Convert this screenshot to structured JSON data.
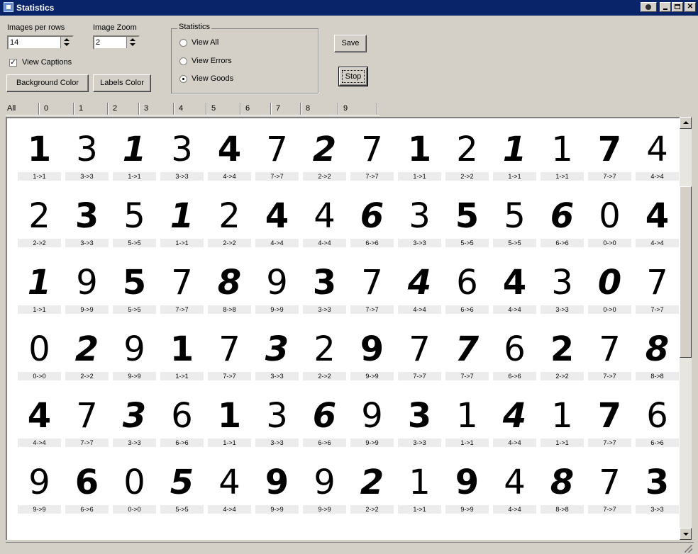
{
  "window": {
    "title": "Statistics"
  },
  "controls": {
    "images_per_row_label": "Images per rows",
    "images_per_row_value": "14",
    "image_zoom_label": "Image Zoom",
    "image_zoom_value": "2",
    "view_captions_label": "View Captions",
    "view_captions_checked": true,
    "background_color_button": "Background Color",
    "labels_color_button": "Labels Color"
  },
  "statistics_group": {
    "title": "Statistics",
    "options": [
      {
        "label": "View All",
        "selected": false
      },
      {
        "label": "View Errors",
        "selected": false
      },
      {
        "label": "View Goods",
        "selected": true
      }
    ]
  },
  "buttons": {
    "save": "Save",
    "stop": "Stop"
  },
  "tabs": [
    "All",
    "0",
    "1",
    "2",
    "3",
    "4",
    "5",
    "6",
    "7",
    "8",
    "9"
  ],
  "active_tab": "All",
  "grid": {
    "rows": [
      {
        "digits": [
          "1",
          "3",
          "1",
          "3",
          "4",
          "7",
          "2",
          "7",
          "1",
          "2",
          "1",
          "1",
          "7",
          "4"
        ],
        "captions": [
          "1->1",
          "3->3",
          "1->1",
          "3->3",
          "4->4",
          "7->7",
          "2->2",
          "7->7",
          "1->1",
          "2->2",
          "1->1",
          "1->1",
          "7->7",
          "4->4"
        ]
      },
      {
        "digits": [
          "2",
          "3",
          "5",
          "1",
          "2",
          "4",
          "4",
          "6",
          "3",
          "5",
          "5",
          "6",
          "0",
          "4"
        ],
        "captions": [
          "2->2",
          "3->3",
          "5->5",
          "1->1",
          "2->2",
          "4->4",
          "4->4",
          "6->6",
          "3->3",
          "5->5",
          "5->5",
          "6->6",
          "0->0",
          "4->4"
        ]
      },
      {
        "digits": [
          "1",
          "9",
          "5",
          "7",
          "8",
          "9",
          "3",
          "7",
          "4",
          "6",
          "4",
          "3",
          "0",
          "7"
        ],
        "captions": [
          "1->1",
          "9->9",
          "5->5",
          "7->7",
          "8->8",
          "9->9",
          "3->3",
          "7->7",
          "4->4",
          "6->6",
          "4->4",
          "3->3",
          "0->0",
          "7->7"
        ]
      },
      {
        "digits": [
          "0",
          "2",
          "9",
          "1",
          "7",
          "3",
          "2",
          "9",
          "7",
          "7",
          "6",
          "2",
          "7",
          "8"
        ],
        "captions": [
          "0->0",
          "2->2",
          "9->9",
          "1->1",
          "7->7",
          "3->3",
          "2->2",
          "9->9",
          "7->7",
          "7->7",
          "6->6",
          "2->2",
          "7->7",
          "8->8"
        ]
      },
      {
        "digits": [
          "4",
          "7",
          "3",
          "6",
          "1",
          "3",
          "6",
          "9",
          "3",
          "1",
          "4",
          "1",
          "7",
          "6"
        ],
        "captions": [
          "4->4",
          "7->7",
          "3->3",
          "6->6",
          "1->1",
          "3->3",
          "6->6",
          "9->9",
          "3->3",
          "1->1",
          "4->4",
          "1->1",
          "7->7",
          "6->6"
        ]
      },
      {
        "digits": [
          "9",
          "6",
          "0",
          "5",
          "4",
          "9",
          "9",
          "2",
          "1",
          "9",
          "4",
          "8",
          "7",
          "3"
        ],
        "captions": [
          "9->9",
          "6->6",
          "0->0",
          "5->5",
          "4->4",
          "9->9",
          "9->9",
          "2->2",
          "1->1",
          "9->9",
          "4->4",
          "8->8",
          "7->7",
          "3->3"
        ]
      }
    ]
  },
  "icons": {
    "app": "app-icon",
    "camera": "camera-icon",
    "minimize": "minimize-icon",
    "maximize": "maximize-icon",
    "close": "close-icon"
  },
  "colors": {
    "titlebar": "#0a246a",
    "face": "#d4d0c8",
    "caption_bg": "#ececec"
  }
}
